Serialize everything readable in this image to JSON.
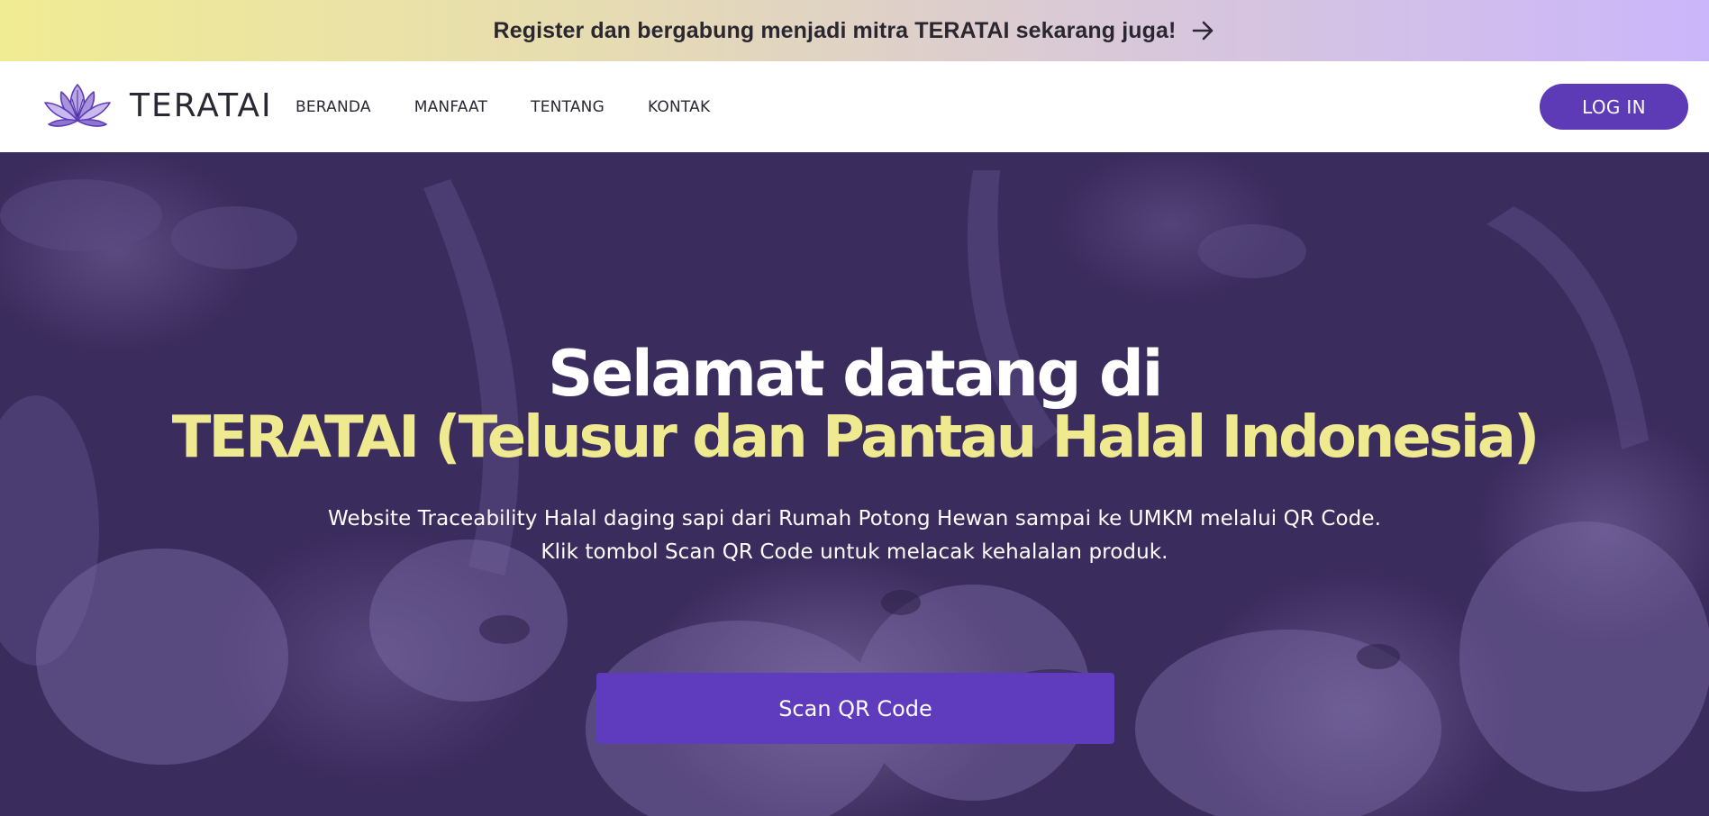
{
  "banner": {
    "text": "Register dan bergabung menjadi mitra TERATAI sekarang juga!",
    "icon": "arrow-right-icon"
  },
  "navbar": {
    "logo_text": "TERATAI",
    "logo_icon": "lotus-icon",
    "items": [
      {
        "label": "BERANDA"
      },
      {
        "label": "MANFAAT"
      },
      {
        "label": "TENTANG"
      },
      {
        "label": "KONTAK"
      }
    ],
    "login_label": "LOG IN"
  },
  "hero": {
    "title_line1": "Selamat datang di",
    "title_line2": "TERATAI (Telusur dan Pantau Halal Indonesia)",
    "subtitle_line1": "Website Traceability Halal daging sapi dari Rumah Potong Hewan sampai ke UMKM melalui QR Code.",
    "subtitle_line2": "Klik tombol Scan QR Code untuk melacak kehalalan produk.",
    "cta_label": "Scan QR Code"
  },
  "colors": {
    "primary": "#5d3bb6",
    "hero_overlay": "#3b2c5e",
    "accent_yellow": "#efea8f",
    "banner_start": "#f0ec93",
    "banner_end": "#cbb6fb"
  }
}
